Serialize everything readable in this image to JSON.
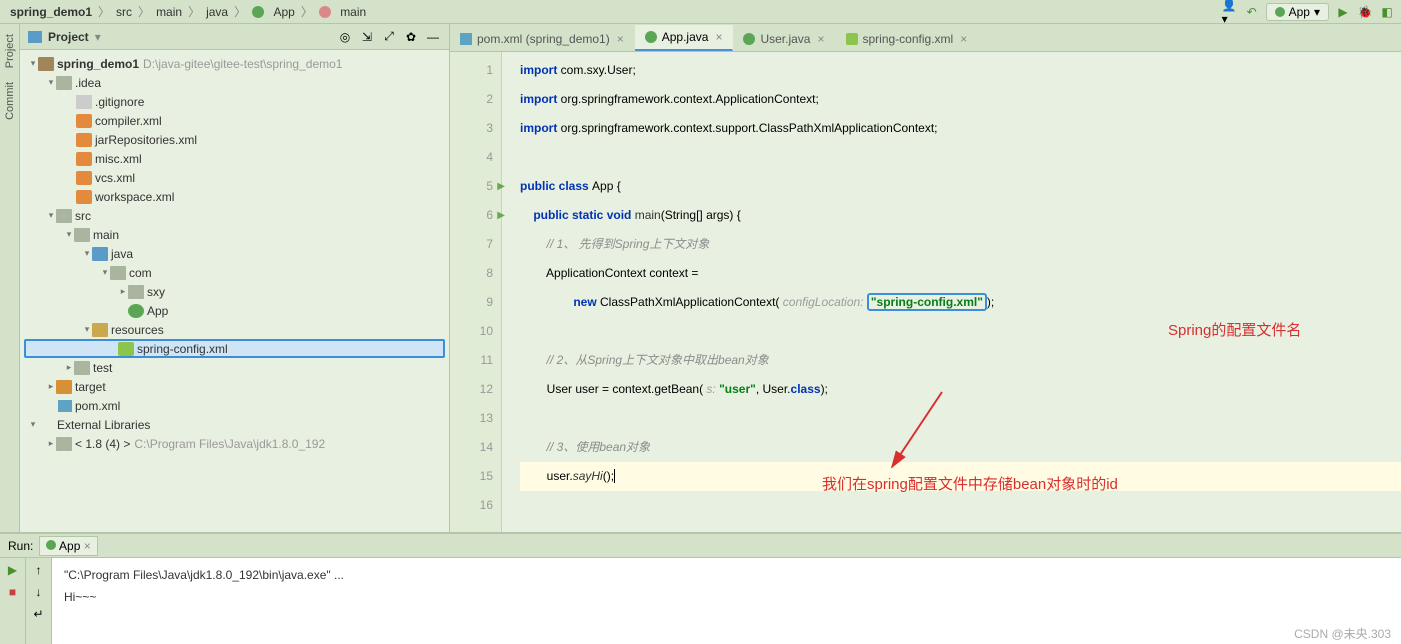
{
  "breadcrumb": {
    "items": [
      "spring_demo1",
      "src",
      "main",
      "java",
      "App",
      "main"
    ],
    "runConfig": "App"
  },
  "sidebar": {
    "tabs": [
      "Project",
      "Commit"
    ]
  },
  "projectPanel": {
    "title": "Project"
  },
  "tree": {
    "root": {
      "name": "spring_demo1",
      "path": "D:\\java-gitee\\gitee-test\\spring_demo1"
    },
    "idea": ".idea",
    "ideaFiles": [
      ".gitignore",
      "compiler.xml",
      "jarRepositories.xml",
      "misc.xml",
      "vcs.xml",
      "workspace.xml"
    ],
    "src": "src",
    "main": "main",
    "java": "java",
    "com": "com",
    "sxy": "sxy",
    "app": "App",
    "resources": "resources",
    "springConfig": "spring-config.xml",
    "test": "test",
    "target": "target",
    "pom": "pom.xml",
    "extLib": "External Libraries",
    "jdk": "< 1.8 (4) >",
    "jdkPath": "C:\\Program Files\\Java\\jdk1.8.0_192"
  },
  "tabs": [
    {
      "label": "pom.xml (spring_demo1)",
      "type": "maven"
    },
    {
      "label": "App.java",
      "type": "java",
      "active": true
    },
    {
      "label": "User.java",
      "type": "java"
    },
    {
      "label": "spring-config.xml",
      "type": "xml"
    }
  ],
  "code": {
    "l1": {
      "kw": "import ",
      "t": "com.sxy.User;"
    },
    "l2": {
      "kw": "import ",
      "t": "org.springframework.context.ApplicationContext;"
    },
    "l3": {
      "kw": "import ",
      "t": "org.springframework.context.support.ClassPathXmlApplicationContext;"
    },
    "l5a": "public class ",
    "l5b": "App {",
    "l6a": "public static void ",
    "l6b": "main",
    "l6c": "(String[] args) {",
    "l7": "// 1、 先得到Spring上下文对象",
    "l8": "ApplicationContext context =",
    "l9a": "new ",
    "l9b": "ClassPathXmlApplicationContext(",
    "l9p": " configLocation: ",
    "l9s": "\"spring-config.xml\"",
    "l9c": ");",
    "l11": "// 2、从Spring上下文对象中取出bean对象",
    "l12a": "User user = context.getBean(",
    "l12p": " s: ",
    "l12s": "\"user\"",
    "l12b": ", User.",
    "l12c": "class",
    "l12d": ");",
    "l14": "// 3、使用bean对象",
    "l15a": "user.",
    "l15b": "sayHi",
    "l15c": "();"
  },
  "annotations": {
    "a1": "Spring的配置文件名",
    "a2": "我们在spring配置文件中存储bean对象时的id"
  },
  "run": {
    "label": "Run:",
    "tab": "App",
    "console": [
      "\"C:\\Program Files\\Java\\jdk1.8.0_192\\bin\\java.exe\" ...",
      "Hi~~~"
    ]
  },
  "watermark": "CSDN @未央.303"
}
